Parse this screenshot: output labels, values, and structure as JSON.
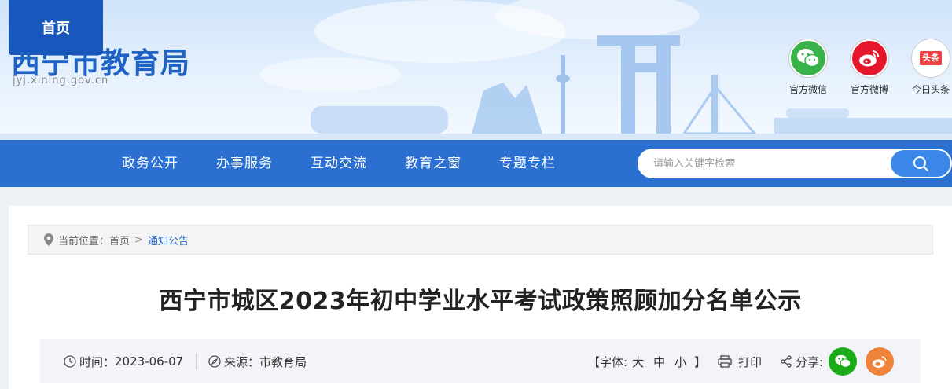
{
  "site": {
    "title": "西宁市教育局",
    "domain": "jyj.xining.gov.cn"
  },
  "social": [
    {
      "label": "官方微信",
      "icon": "wechat-icon",
      "color": "#37b34a"
    },
    {
      "label": "官方微博",
      "icon": "weibo-icon",
      "color": "#e6162d"
    },
    {
      "label": "今日头条",
      "icon": "toutiao-icon",
      "color": "#f04142",
      "badge": "头条"
    }
  ],
  "nav": {
    "home": "首页",
    "items": [
      "政务公开",
      "办事服务",
      "互动交流",
      "教育之窗",
      "专题专栏"
    ]
  },
  "search": {
    "placeholder": "请输入关键字检索",
    "icon": "search-icon"
  },
  "breadcrumb": {
    "prefix": "当前位置：",
    "home": "首页",
    "separator": ">",
    "current": "通知公告"
  },
  "article": {
    "title": "西宁市城区2023年初中学业水平考试政策照顾加分名单公示",
    "time_label": "时间：",
    "time": "2023-06-07",
    "source_label": "来源：",
    "source": "市教育局",
    "font_label": "【字体:",
    "font_large": "大",
    "font_medium": "中",
    "font_small": "小",
    "font_close": "】",
    "print": "打印",
    "share": "分享:"
  },
  "colors": {
    "primary": "#2b6fd0",
    "home_active": "#1858bd",
    "title_blue": "#1d62c4",
    "share_wechat": "#1aad19",
    "share_weibo": "#f0833a"
  }
}
